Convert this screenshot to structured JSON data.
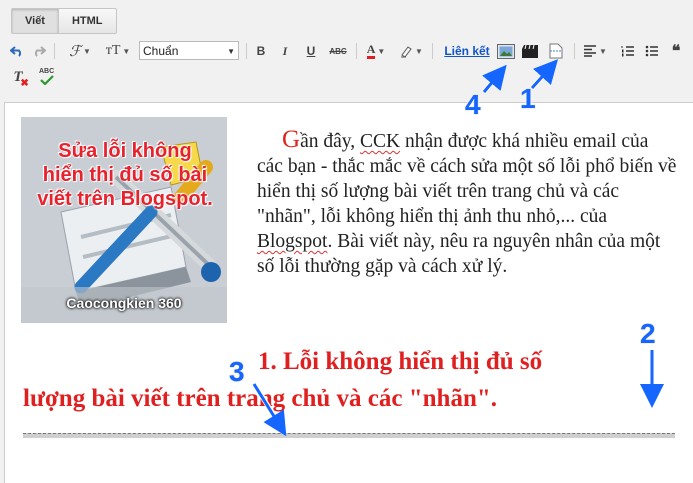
{
  "tabs": {
    "compose": "Viết",
    "html": "HTML"
  },
  "toolbar": {
    "undo_icon": "undo-icon",
    "redo_icon": "redo-icon",
    "font_family_icon": "font-family-icon",
    "font_size_icon": "font-size-icon",
    "format_value": "Chuẩn",
    "bold": "B",
    "italic": "I",
    "underline": "U",
    "strike": "ABC",
    "text_color": "A",
    "link_label": "Liên kết",
    "quote": "❝"
  },
  "toolbar2": {
    "remove_format": "T",
    "spellcheck": "ABC"
  },
  "post": {
    "image": {
      "title": "Sửa lỗi không hiển thị đủ số bài viết trên Blogspot.",
      "caption": "Caocongkien 360"
    },
    "intro_dropcap": "G",
    "intro_line1": "ần đây, ",
    "intro_cck": "CCK",
    "intro_line1b": " nhận được khá nhiều",
    "intro_rest": "email của các bạn - thắc mắc về cách sửa một số lỗi phổ biến về hiển thị số lượng bài viết trên trang chủ và các \"nhãn\", lỗi không hiển thị ảnh thu nhỏ,... của ",
    "intro_blogspot": "Blogspot",
    "intro_end": ". Bài viết này, nêu ra nguyên nhân của một số lỗi thường gặp và cách xử lý.",
    "heading_line1": "1. Lỗi không hiển thị đủ số",
    "heading_line2": "lượng bài viết trên trang chủ và các \"nhãn\"."
  },
  "annotations": {
    "n1": "1",
    "n2": "2",
    "n3": "3",
    "n4": "4"
  },
  "colors": {
    "annotation": "#1565ff",
    "heading": "#e02020",
    "dropcap": "#e0241b",
    "link": "#1155cc"
  }
}
